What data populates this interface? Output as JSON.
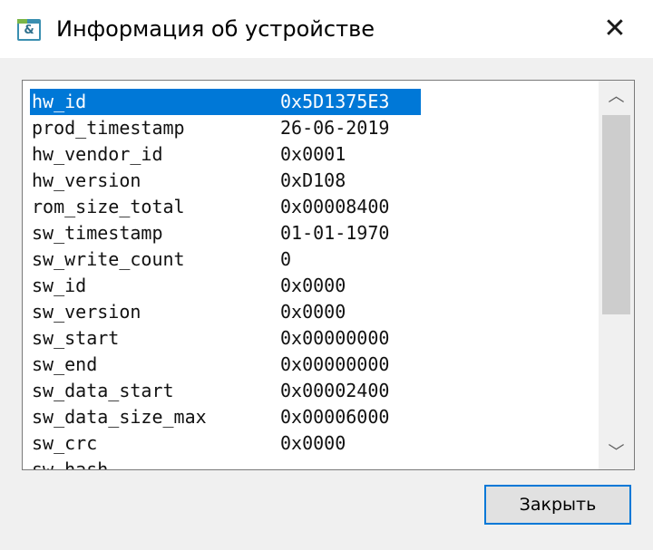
{
  "window": {
    "title": "Информация об устройстве",
    "icon": "app-ampersand-icon",
    "icon_glyph": "&",
    "close_glyph": "✕"
  },
  "list": {
    "selected_index": 0,
    "rows": [
      {
        "key": "hw_id",
        "value": "0x5D1375E3"
      },
      {
        "key": "prod_timestamp",
        "value": "26-06-2019"
      },
      {
        "key": "hw_vendor_id",
        "value": "0x0001"
      },
      {
        "key": "hw_version",
        "value": "0xD108"
      },
      {
        "key": "rom_size_total",
        "value": "0x00008400"
      },
      {
        "key": "sw_timestamp",
        "value": "01-01-1970"
      },
      {
        "key": "sw_write_count",
        "value": "0"
      },
      {
        "key": "sw_id",
        "value": "0x0000"
      },
      {
        "key": "sw_version",
        "value": "0x0000"
      },
      {
        "key": "sw_start",
        "value": "0x00000000"
      },
      {
        "key": "sw_end",
        "value": "0x00000000"
      },
      {
        "key": "sw_data_start",
        "value": "0x00002400"
      },
      {
        "key": "sw_data_size_max",
        "value": "0x00006000"
      },
      {
        "key": "sw_crc",
        "value": "0x0000"
      },
      {
        "key": "sw_hash",
        "value": ""
      }
    ],
    "scroll_up_glyph": "︿",
    "scroll_down_glyph": "﹀"
  },
  "footer": {
    "close_label": "Закрыть"
  },
  "colors": {
    "selection": "#0078d7",
    "button_border": "#0078d7"
  }
}
